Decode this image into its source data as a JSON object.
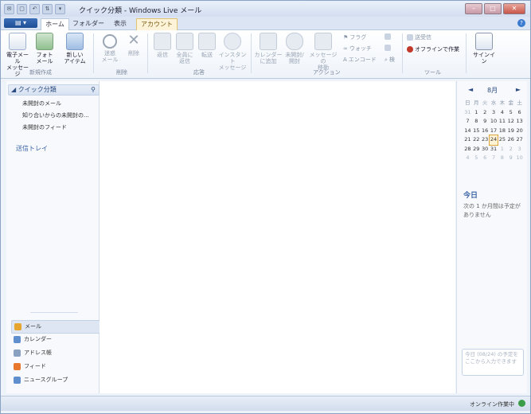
{
  "window": {
    "title": "クイック分類 - Windows Live メール"
  },
  "qat_icons": [
    "app-icon",
    "new-mail-icon",
    "reply-icon",
    "send-receive-icon",
    "dropdown-icon"
  ],
  "tabs": [
    {
      "label": "ホーム",
      "active": true
    },
    {
      "label": "フォルダー",
      "active": false
    },
    {
      "label": "表示",
      "active": false
    },
    {
      "label": "アカウント",
      "active": false,
      "highlight": true
    }
  ],
  "ribbon": {
    "groups": {
      "new": "新規作成",
      "delete": "削除",
      "respond": "応答",
      "actions": "アクション",
      "tools": "ツール"
    },
    "buttons": {
      "email_message": "電子メール\nメッセージ",
      "photo_email": "フォト\nメール",
      "new_items": "新しい\nアイテム",
      "junk": "迷惑\nメール",
      "delete": "削除",
      "reply": "返信",
      "reply_all": "全員に\n返信",
      "forward": "転送",
      "instant_message": "インスタント\nメッセージ",
      "add_calendar": "カレンダー\nに追加",
      "unread_read": "未開封/\n開封",
      "move_message": "メッセージの\n移動",
      "flag": "フラグ",
      "watch": "ウォッチ",
      "encoding": "エンコード",
      "find": "検",
      "send_receive": "送受信",
      "work_offline": "オフラインで作業",
      "sign_in": "サインイン"
    }
  },
  "quick_views": {
    "header": "クイック分類",
    "items": [
      "未開封のメール",
      "知り合いからの未開封の...",
      "未開封のフィード"
    ],
    "outbox": "送信トレイ"
  },
  "nav": [
    {
      "label": "メール",
      "icon": "mail-icon",
      "active": true,
      "color": "#e6a530"
    },
    {
      "label": "カレンダー",
      "icon": "calendar-icon",
      "active": false,
      "color": "#5f8fcf"
    },
    {
      "label": "アドレス帳",
      "icon": "contacts-icon",
      "active": false,
      "color": "#8aa0c0"
    },
    {
      "label": "フィード",
      "icon": "feed-icon",
      "active": false,
      "color": "#e8762c"
    },
    {
      "label": "ニュースグループ",
      "icon": "newsgroup-icon",
      "active": false,
      "color": "#5f8fcf"
    }
  ],
  "calendar": {
    "month": "8月",
    "prev": "◄",
    "next": "►",
    "weekdays": [
      "日",
      "月",
      "火",
      "水",
      "木",
      "金",
      "土"
    ],
    "weeks": [
      [
        "31",
        "1",
        "2",
        "3",
        "4",
        "5",
        "6"
      ],
      [
        "7",
        "8",
        "9",
        "10",
        "11",
        "12",
        "13"
      ],
      [
        "14",
        "15",
        "16",
        "17",
        "18",
        "19",
        "20"
      ],
      [
        "21",
        "22",
        "23",
        "24",
        "25",
        "26",
        "27"
      ],
      [
        "28",
        "29",
        "30",
        "31",
        "1",
        "2",
        "3"
      ],
      [
        "4",
        "5",
        "6",
        "7",
        "8",
        "9",
        "10"
      ]
    ],
    "today_day": "24",
    "today_title": "今日",
    "today_text": "次の 1 か月間は予定がありません",
    "note_placeholder": "今日 (08/24) の予定をここから入力できます"
  },
  "status": {
    "text": "オンライン作業中"
  },
  "colors": {
    "accent": "#3b64a6",
    "file_button": "#2a5ea8"
  }
}
